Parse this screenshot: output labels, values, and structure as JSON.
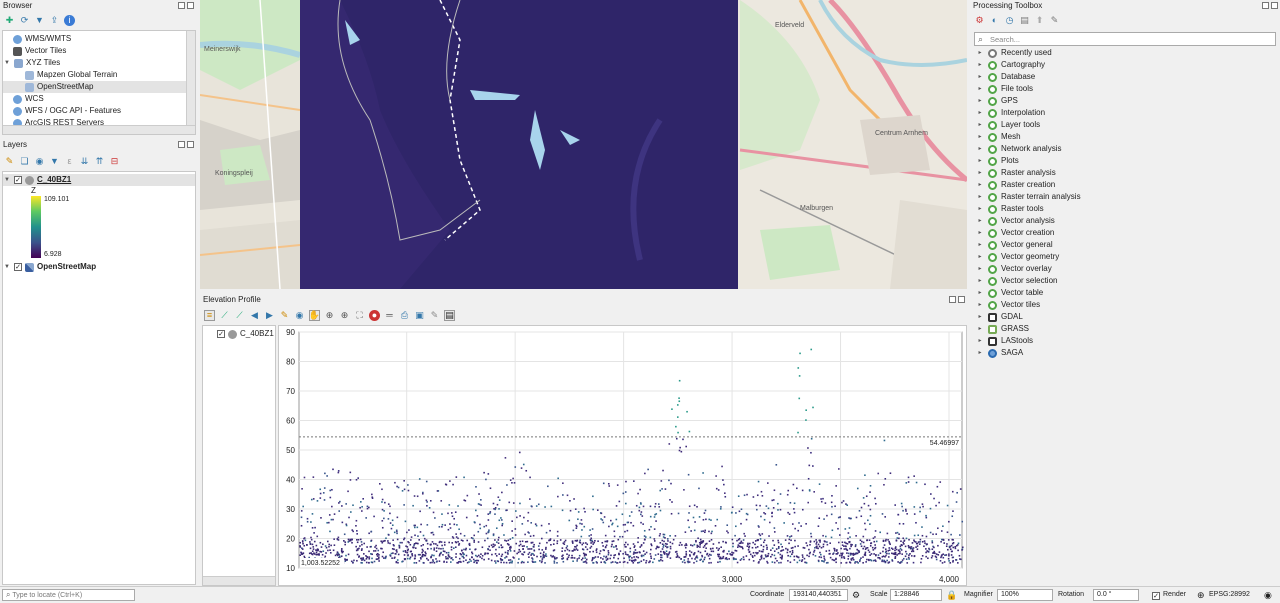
{
  "browser": {
    "title": "Browser",
    "items": [
      {
        "label": "WMS/WMTS",
        "indent": 1
      },
      {
        "label": "Vector Tiles",
        "indent": 1
      },
      {
        "label": "XYZ Tiles",
        "indent": 1
      },
      {
        "label": "Mapzen Global Terrain",
        "indent": 2
      },
      {
        "label": "OpenStreetMap",
        "indent": 2
      },
      {
        "label": "WCS",
        "indent": 1
      },
      {
        "label": "WFS / OGC API - Features",
        "indent": 1
      },
      {
        "label": "ArcGIS REST Servers",
        "indent": 1
      }
    ]
  },
  "layers": {
    "title": "Layers",
    "layer1": {
      "name": "C_40BZ1",
      "legend_title": "Z",
      "max": "109.101",
      "min": "6.928"
    },
    "layer2": {
      "name": "OpenStreetMap"
    }
  },
  "elevation": {
    "title": "Elevation Profile",
    "legend_item": "C_40BZ1",
    "bottom_left": "1,003.52252",
    "ref_line_label": "54.46997"
  },
  "chart_data": {
    "type": "scatter",
    "title": "",
    "xlabel": "",
    "ylabel": "",
    "xlim": [
      1003.52252,
      4060
    ],
    "ylim": [
      10,
      90
    ],
    "x_ticks": [
      "1,500",
      "2,000",
      "2,500",
      "3,000",
      "3,500",
      "4,000"
    ],
    "x_tick_values": [
      1500,
      2000,
      2500,
      3000,
      3500,
      4000
    ],
    "y_ticks": [
      "10",
      "20",
      "30",
      "40",
      "50",
      "60",
      "70",
      "80",
      "90"
    ],
    "y_tick_values": [
      10,
      20,
      30,
      40,
      50,
      60,
      70,
      80,
      90
    ],
    "reference_line": 54.46997,
    "grid": true,
    "series": [
      {
        "name": "C_40BZ1",
        "color": "#3b2d7e"
      }
    ]
  },
  "processing": {
    "title": "Processing Toolbox",
    "search_placeholder": "Search...",
    "items": [
      "Recently used",
      "Cartography",
      "Database",
      "File tools",
      "GPS",
      "Interpolation",
      "Layer tools",
      "Mesh",
      "Network analysis",
      "Plots",
      "Raster analysis",
      "Raster creation",
      "Raster terrain analysis",
      "Raster tools",
      "Vector analysis",
      "Vector creation",
      "Vector general",
      "Vector geometry",
      "Vector overlay",
      "Vector selection",
      "Vector table",
      "Vector tiles",
      "GDAL",
      "GRASS",
      "LAStools",
      "SAGA"
    ]
  },
  "status": {
    "locate_placeholder": "Type to locate (Ctrl+K)",
    "coordinate_label": "Coordinate",
    "coordinate_value": "193140,440351",
    "scale_label": "Scale",
    "scale_value": "1:28846",
    "magnifier_label": "Magnifier",
    "magnifier_value": "100%",
    "rotation_label": "Rotation",
    "rotation_value": "0.0 °",
    "render_label": "Render",
    "crs": "EPSG:28992"
  },
  "map": {
    "labels": [
      "Meinerswijk",
      "Elderveld",
      "Centrum Arnhem",
      "Malburgen",
      "Koningspleij"
    ]
  },
  "colors": {
    "osm_bg": "#eae6de",
    "raster": "#2f2569",
    "accent": "#52a447"
  }
}
